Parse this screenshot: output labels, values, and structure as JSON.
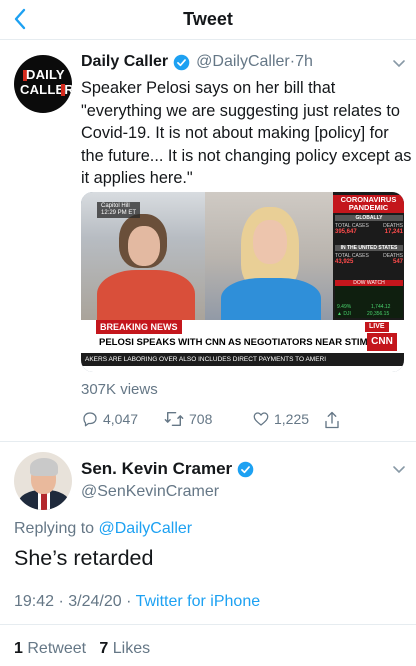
{
  "header": {
    "title": "Tweet"
  },
  "original_tweet": {
    "avatar_text_line1": "DAILY",
    "avatar_text_line2": "CALLER",
    "name": "Daily Caller",
    "handle": "@DailyCaller",
    "separator": "·",
    "time_ago": "7h",
    "text": "Speaker Pelosi says on her bill that \"everything we are suggesting just relates to Covid-19. It is not about making [policy] for the future... It is not changing policy except as it applies here.\"",
    "video": {
      "location_line1": "Capitol Hill",
      "location_line2": "12:29 PM ET",
      "breaking_label": "BREAKING NEWS",
      "live_label": "LIVE",
      "headline": "PELOSI SPEAKS WITH CNN AS NEGOTIATORS NEAR STIMULUS DEAL",
      "network_logo": "CNN",
      "ticker": "AKERS ARE LABORING OVER ALSO INCLUDES DIRECT PAYMENTS TO AMERI",
      "panel": {
        "title_line1": "CORONAVIRUS",
        "title_line2": "PANDEMIC",
        "global_label": "GLOBALLY",
        "global_cases_label": "TOTAL CASES",
        "global_deaths_label": "DEATHS",
        "global_cases": "395,647",
        "global_deaths": "17,241",
        "us_label": "IN THE UNITED STATES",
        "us_cases_label": "TOTAL CASES",
        "us_deaths_label": "DEATHS",
        "us_cases": "43,925",
        "us_deaths": "547",
        "dow_label": "DOW WATCH",
        "dow_pct": "9.49%",
        "dow_value": "1,744.12",
        "dow_sub_label": "▲ DJI",
        "dow_level": "20,356.15"
      }
    },
    "views": "307K views",
    "replies": "4,047",
    "retweets": "708",
    "likes": "1,225"
  },
  "reply_tweet": {
    "name": "Sen. Kevin Cramer",
    "handle": "@SenKevinCramer",
    "replying_prefix": "Replying to",
    "replying_to": "@DailyCaller",
    "text": "She’s retarded",
    "time": "19:42",
    "date": "3/24/20",
    "separator": "·",
    "source": "Twitter for iPhone",
    "retweet_count": "1",
    "retweet_label": "Retweet",
    "like_count": "7",
    "like_label": "Likes"
  },
  "colors": {
    "accent": "#1da1f2",
    "secondary_text": "#657786",
    "divider": "#e6ecf0",
    "cnn_red": "#c4161c"
  },
  "icons": [
    "back-chevron-icon",
    "verified-badge-icon",
    "chevron-down-icon",
    "reply-icon",
    "retweet-icon",
    "like-icon",
    "share-icon"
  ]
}
